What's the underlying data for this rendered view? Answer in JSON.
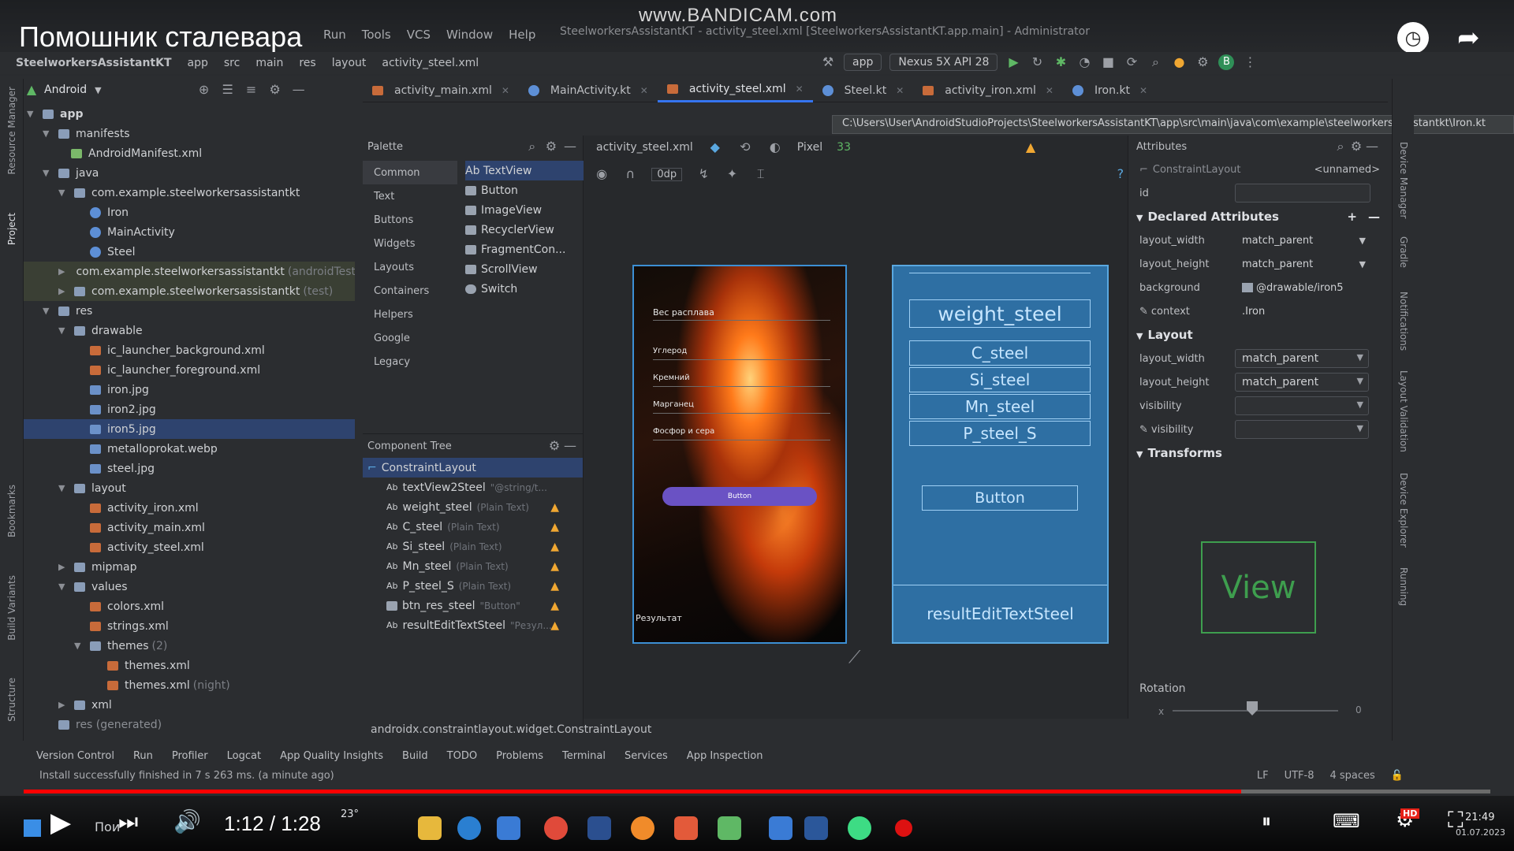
{
  "video": {
    "title": "Помошник сталевара",
    "watermark": "www.BANDICAM.com",
    "time": "1:12 / 1:28",
    "progress_fraction": 0.83,
    "hd_badge": "HD"
  },
  "ide": {
    "menu": [
      "Run",
      "Tools",
      "VCS",
      "Window",
      "Help"
    ],
    "window_title": "SteelworkersAssistantKT - activity_steel.xml [SteelworkersAssistantKT.app.main] - Administrator",
    "breadcrumb": [
      "SteelworkersAssistantKT",
      "app",
      "src",
      "main",
      "res",
      "layout",
      "activity_steel.xml"
    ],
    "run_config": "app",
    "device": "Nexus 5X API 28",
    "project_view": "Android",
    "tabs": [
      {
        "label": "activity_main.xml"
      },
      {
        "label": "MainActivity.kt"
      },
      {
        "label": "activity_steel.xml"
      },
      {
        "label": "Steel.kt"
      },
      {
        "label": "activity_iron.xml"
      },
      {
        "label": "Iron.kt"
      }
    ],
    "path_tooltip": "C:\\Users\\User\\AndroidStudioProjects\\SteelworkersAssistantKT\\app\\src\\main\\java\\com\\example\\steelworkersassistantkt\\Iron.kt",
    "tree": [
      {
        "label": "app",
        "indent": 0
      },
      {
        "label": "manifests",
        "indent": 1
      },
      {
        "label": "AndroidManifest.xml",
        "indent": 2
      },
      {
        "label": "java",
        "indent": 1
      },
      {
        "label": "com.example.steelworkersassistantkt",
        "indent": 2
      },
      {
        "label": "Iron",
        "indent": 3
      },
      {
        "label": "MainActivity",
        "indent": 3
      },
      {
        "label": "Steel",
        "indent": 3
      },
      {
        "label": "com.example.steelworkersassistantkt",
        "dim": "(androidTest)",
        "indent": 2
      },
      {
        "label": "com.example.steelworkersassistantkt",
        "dim": "(test)",
        "indent": 2
      },
      {
        "label": "res",
        "indent": 1
      },
      {
        "label": "drawable",
        "indent": 2
      },
      {
        "label": "ic_launcher_background.xml",
        "indent": 3
      },
      {
        "label": "ic_launcher_foreground.xml",
        "indent": 3
      },
      {
        "label": "iron.jpg",
        "indent": 3
      },
      {
        "label": "iron2.jpg",
        "indent": 3
      },
      {
        "label": "iron5.jpg",
        "indent": 3
      },
      {
        "label": "metalloprokat.webp",
        "indent": 3
      },
      {
        "label": "steel.jpg",
        "indent": 3
      },
      {
        "label": "layout",
        "indent": 2
      },
      {
        "label": "activity_iron.xml",
        "indent": 3
      },
      {
        "label": "activity_main.xml",
        "indent": 3
      },
      {
        "label": "activity_steel.xml",
        "indent": 3
      },
      {
        "label": "mipmap",
        "indent": 2
      },
      {
        "label": "values",
        "indent": 2
      },
      {
        "label": "colors.xml",
        "indent": 3
      },
      {
        "label": "strings.xml",
        "indent": 3
      },
      {
        "label": "themes",
        "dim": "(2)",
        "indent": 3
      },
      {
        "label": "themes.xml",
        "indent": 4
      },
      {
        "label": "themes.xml",
        "dim": "(night)",
        "indent": 4
      },
      {
        "label": "xml",
        "indent": 2
      },
      {
        "label": "res (generated)",
        "indent": 1
      }
    ],
    "palette": {
      "title": "Palette",
      "categories": [
        "Common",
        "Text",
        "Buttons",
        "Widgets",
        "Layouts",
        "Containers",
        "Helpers",
        "Google",
        "Legacy"
      ],
      "items": [
        "Ab TextView",
        "Button",
        "ImageView",
        "RecyclerView",
        "FragmentCon...",
        "ScrollView",
        "Switch"
      ]
    },
    "component_tree": {
      "title": "Component Tree",
      "root": "ConstraintLayout",
      "children": [
        {
          "name": "textView2Steel",
          "hint": "\"@string/t...",
          "warn": false
        },
        {
          "name": "weight_steel",
          "hint": "(Plain Text)",
          "warn": true
        },
        {
          "name": "C_steel",
          "hint": "(Plain Text)",
          "warn": true
        },
        {
          "name": "Si_steel",
          "hint": "(Plain Text)",
          "warn": true
        },
        {
          "name": "Mn_steel",
          "hint": "(Plain Text)",
          "warn": true
        },
        {
          "name": "P_steel_S",
          "hint": "(Plain Text)",
          "warn": true
        },
        {
          "name": "btn_res_steel",
          "hint": "\"Button\"",
          "warn": true
        },
        {
          "name": "resultEditTextSteel",
          "hint": "\"Резул...",
          "warn": true
        }
      ]
    },
    "design_toolbar": {
      "file": "activity_steel.xml",
      "device": "Pixel",
      "api": "33",
      "margin": "0dp"
    },
    "phone_preview": {
      "labels": [
        "Вес расплава",
        "Углерод",
        "Кремний",
        "Марганец",
        "Фосфор и сера"
      ],
      "button": "Button",
      "result": "Результат"
    },
    "blueprint": {
      "fields": [
        "weight_steel",
        "C_steel",
        "Si_steel",
        "Mn_steel",
        "P_steel_S"
      ],
      "button": "Button",
      "result": "resultEditTextSteel"
    },
    "attributes": {
      "title": "Attributes",
      "component": "ConstraintLayout",
      "component_name": "<unnamed>",
      "id_label": "id",
      "declared_title": "Declared Attributes",
      "declared": [
        {
          "name": "layout_width",
          "value": "match_parent"
        },
        {
          "name": "layout_height",
          "value": "match_parent"
        },
        {
          "name": "background",
          "value": "@drawable/iron5"
        },
        {
          "name": "context",
          "value": ".Iron"
        }
      ],
      "layout_title": "Layout",
      "layout": [
        {
          "name": "layout_width",
          "value": "match_parent"
        },
        {
          "name": "layout_height",
          "value": "match_parent"
        },
        {
          "name": "visibility",
          "value": ""
        },
        {
          "name": "visibility",
          "value": ""
        }
      ],
      "transforms_title": "Transforms",
      "view_label": "View",
      "rotation_label": "Rotation",
      "rotation_axis": "x",
      "rotation_value": "0"
    },
    "class_path": "androidx.constraintlayout.widget.ConstraintLayout",
    "bottom_tabs": [
      "Version Control",
      "Run",
      "Profiler",
      "Logcat",
      "App Quality Insights",
      "Build",
      "TODO",
      "Problems",
      "Terminal",
      "Services",
      "App Inspection"
    ],
    "status": "Install successfully finished in 7 s 263 ms. (a minute ago)",
    "status_right": [
      "LF",
      "UTF-8",
      "4 spaces"
    ],
    "side_left": [
      "Resource Manager",
      "Project",
      "Bookmarks",
      "Build Variants",
      "Structure"
    ],
    "side_right": [
      "Device Manager",
      "Gradle",
      "Notifications",
      "Layout Validation",
      "Device Explorer",
      "Running"
    ]
  },
  "taskbar": {
    "search_placeholder": "Пои",
    "weather": "23°",
    "clock_time": "21:49",
    "clock_date": "01.07.2023"
  },
  "colors": {
    "accent": "#3574f0",
    "warning": "#f0a732",
    "progress": "#ff0000",
    "blueprint": "#2e6fa3"
  }
}
